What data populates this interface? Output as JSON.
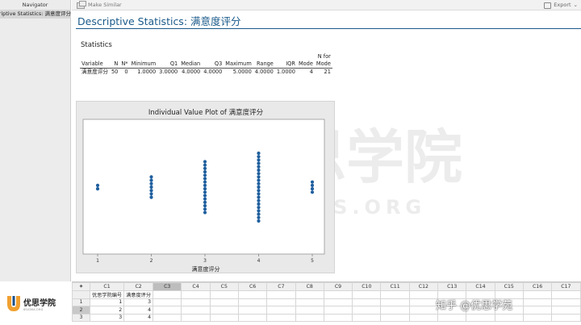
{
  "navigator": {
    "title": "Navigator",
    "selected_item": "Descriptive Statistics: 满意度评分"
  },
  "toolbar": {
    "make_similar_label": "Make Similar",
    "export_label": "Export"
  },
  "output": {
    "title": "Descriptive Statistics: 满意度评分",
    "statistics_heading": "Statistics",
    "table": {
      "header_top": [
        "",
        "",
        "",
        "",
        "",
        "",
        "",
        "",
        "",
        "",
        "",
        "N for"
      ],
      "headers": [
        "Variable",
        "N",
        "N*",
        "Minimum",
        "Q1",
        "Median",
        "Q3",
        "Maximum",
        "Range",
        "IQR",
        "Mode",
        "Mode"
      ],
      "row": [
        "满意度评分",
        "50",
        "0",
        "1.0000",
        "3.0000",
        "4.0000",
        "4.0000",
        "5.0000",
        "4.0000",
        "1.0000",
        "4",
        "21"
      ]
    }
  },
  "chart_data": {
    "type": "scatter",
    "title": "Individual Value Plot of 满意度评分",
    "xlabel": "满意度评分",
    "ylabel": "",
    "x_ticks": [
      "1",
      "2",
      "3",
      "4",
      "5"
    ],
    "counts": [
      {
        "value": 1,
        "count": 2
      },
      {
        "value": 2,
        "count": 7
      },
      {
        "value": 3,
        "count": 16
      },
      {
        "value": 4,
        "count": 21
      },
      {
        "value": 5,
        "count": 4
      }
    ],
    "grid": false,
    "point_color": "#1f5f9e"
  },
  "worksheet": {
    "columns": [
      "C1",
      "C2",
      "C3",
      "C4",
      "C5",
      "C6",
      "C7",
      "C8",
      "C9",
      "C10",
      "C11",
      "C12",
      "C13",
      "C14",
      "C15",
      "C16",
      "C17"
    ],
    "selected_column": "C3",
    "column_names": [
      "优思学院编号",
      "满意度评分"
    ],
    "rows": [
      {
        "row": "1",
        "values": [
          "1",
          "3"
        ]
      },
      {
        "row": "2",
        "values": [
          "2",
          "4"
        ]
      },
      {
        "row": "3",
        "values": [
          "3",
          "4"
        ]
      }
    ]
  },
  "watermark": {
    "brand_text": "优思学院",
    "brand_sub": "USOURS.ORG"
  },
  "logos": {
    "left_brand": "优思学院",
    "left_sub": "6SIGMA.ORG",
    "right_text": "知乎 @优思学苑"
  },
  "colors": {
    "title_blue": "#1a5a8a",
    "plot_point": "#1f5f9e",
    "watermark_orange": "#f5c28a"
  }
}
